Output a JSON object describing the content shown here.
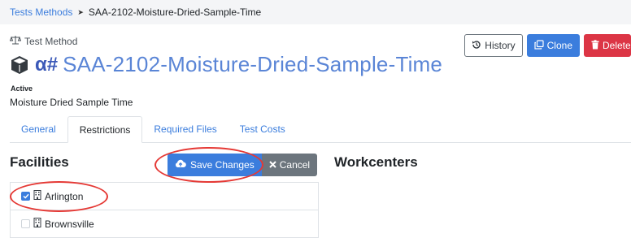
{
  "breadcrumb": {
    "parent": "Tests Methods",
    "separator": "➤",
    "current": "SAA-2102-Moisture-Dried-Sample-Time"
  },
  "header": {
    "section_label": "Test Method",
    "alpha_prefix": "α#",
    "title": "SAA-2102-Moisture-Dried-Sample-Time",
    "status": "Active",
    "subtitle": "Moisture Dried Sample Time",
    "icons": {
      "section": "scale-icon",
      "title": "cube-icon"
    }
  },
  "actions": {
    "history_label": "History",
    "clone_label": "Clone",
    "delete_label": "Delete"
  },
  "tabs": [
    {
      "label": "General",
      "active": false
    },
    {
      "label": "Restrictions",
      "active": true
    },
    {
      "label": "Required Files",
      "active": false
    },
    {
      "label": "Test Costs",
      "active": false
    }
  ],
  "restrictions": {
    "facilities_heading": "Facilities",
    "workcenters_heading": "Workcenters",
    "save_label": "Save Changes",
    "cancel_label": "Cancel",
    "facilities": [
      {
        "name": "Arlington",
        "checked": true
      },
      {
        "name": "Brownsville",
        "checked": false
      }
    ]
  },
  "colors": {
    "primary": "#3b7ddd",
    "secondary": "#6c757d",
    "danger": "#dc3545",
    "annotation": "#e53935"
  }
}
